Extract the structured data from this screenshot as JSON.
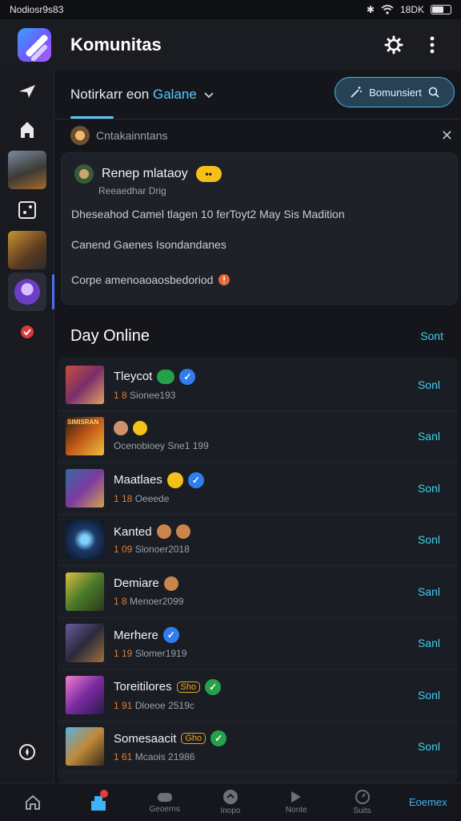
{
  "status_bar": {
    "left_text": "Nodiosr9s83",
    "right_text": "18DK"
  },
  "header": {
    "title": "Komunitas"
  },
  "filter": {
    "tab_prefix": "Notirkarr eon",
    "tab_accent": "Galane",
    "button_label": "Bomunsiert"
  },
  "notification": {
    "heading": "Cntakainntans",
    "user_name": "Renep mlataoy",
    "emoji": "••",
    "user_sub": "Reeaedhar Drig",
    "line1": "Dheseahod Camel tlagen 10 ferToyt2 May Sis Madition",
    "line2": "Canend Gaenes Isondandanes",
    "line3": "Corpe amenoaoaosbedoriod"
  },
  "section": {
    "title": "Day Online",
    "action": "Sont"
  },
  "rows": [
    {
      "title": "Tleycot",
      "sub_num": "1 8",
      "sub_text": "Sionee193",
      "action": "Sonl"
    },
    {
      "title": "",
      "sub_num": "",
      "sub_text": "Ocenobioey Sne1 199",
      "action": "Sanl",
      "thumb_label": "SIMISRAN"
    },
    {
      "title": "Maatlaes",
      "sub_num": "1 18",
      "sub_text": "Oeeede",
      "action": "Sonl"
    },
    {
      "title": "Kanted",
      "sub_num": "1 09",
      "sub_text": "Slonoer2018",
      "action": "Sonl"
    },
    {
      "title": "Demiare",
      "sub_num": "1 8",
      "sub_text": "Menoer2099",
      "action": "Sanl"
    },
    {
      "title": "Merhere",
      "sub_num": "1 19",
      "sub_text": "Slomer1919",
      "action": "Sanl"
    },
    {
      "title": "Toreitilores",
      "sub_num": "1 91",
      "sub_text": "Dloeoe 2519c",
      "action": "Sonl",
      "tag": "Sho"
    },
    {
      "title": "Somesaacit",
      "sub_num": "1 61",
      "sub_text": "Mcaois 21986",
      "action": "Sonl",
      "tag": "Gho"
    }
  ],
  "bottom_nav": [
    {
      "label": ""
    },
    {
      "label": ""
    },
    {
      "label": "Geoerns"
    },
    {
      "label": "Inopo"
    },
    {
      "label": "Nonte"
    },
    {
      "label": "Suits"
    },
    {
      "label": "Eoemex"
    }
  ],
  "colors": {
    "accent": "#3fd0f0",
    "underline": "#5cc7ff",
    "badge_blue": "#2f7ef0",
    "badge_green": "#25a14a",
    "badge_yellow": "#f5c018"
  }
}
